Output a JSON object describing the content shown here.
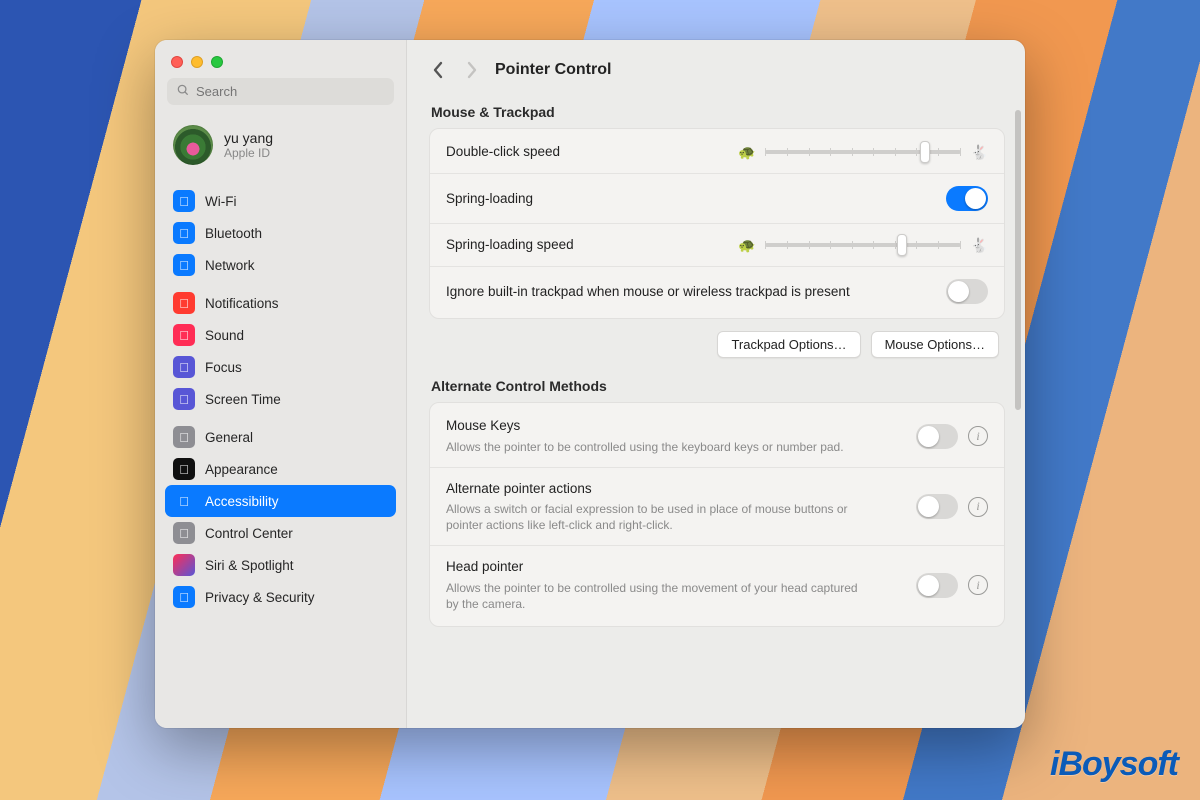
{
  "window": {
    "title": "Pointer Control"
  },
  "search": {
    "placeholder": "Search"
  },
  "account": {
    "name": "yu yang",
    "sub": "Apple ID"
  },
  "sidebar": {
    "selected": "accessibility",
    "groups": [
      {
        "items": [
          {
            "id": "wifi",
            "label": "Wi-Fi",
            "iconClass": "ic-wifi",
            "glyph": "􀙇"
          },
          {
            "id": "bluetooth",
            "label": "Bluetooth",
            "iconClass": "ic-bt",
            "glyph": "􀖀"
          },
          {
            "id": "network",
            "label": "Network",
            "iconClass": "ic-net",
            "glyph": "􀤆"
          }
        ]
      },
      {
        "items": [
          {
            "id": "notifications",
            "label": "Notifications",
            "iconClass": "ic-notif",
            "glyph": "􀋚"
          },
          {
            "id": "sound",
            "label": "Sound",
            "iconClass": "ic-sound",
            "glyph": "􀊨"
          },
          {
            "id": "focus",
            "label": "Focus",
            "iconClass": "ic-focus",
            "glyph": "􀆺"
          },
          {
            "id": "screentime",
            "label": "Screen Time",
            "iconClass": "ic-screen",
            "glyph": "􀐫"
          }
        ]
      },
      {
        "items": [
          {
            "id": "general",
            "label": "General",
            "iconClass": "ic-general",
            "glyph": "􀍟"
          },
          {
            "id": "appearance",
            "label": "Appearance",
            "iconClass": "ic-appear",
            "glyph": "􀀻"
          },
          {
            "id": "accessibility",
            "label": "Accessibility",
            "iconClass": "ic-access",
            "glyph": "􀕽"
          },
          {
            "id": "controlcenter",
            "label": "Control Center",
            "iconClass": "ic-cc",
            "glyph": "􀜊"
          },
          {
            "id": "siri",
            "label": "Siri & Spotlight",
            "iconClass": "ic-siri",
            "glyph": ""
          },
          {
            "id": "privacy",
            "label": "Privacy & Security",
            "iconClass": "ic-priv",
            "glyph": "􀉼"
          }
        ]
      }
    ]
  },
  "sections": {
    "mouseTrackpad": {
      "title": "Mouse & Trackpad",
      "doubleClick": {
        "label": "Double-click speed",
        "value": 0.82
      },
      "springLoading": {
        "label": "Spring-loading",
        "on": true
      },
      "springSpeed": {
        "label": "Spring-loading speed",
        "value": 0.7
      },
      "ignoreTrackpad": {
        "label": "Ignore built-in trackpad when mouse or wireless trackpad is present",
        "on": false
      },
      "buttons": {
        "trackpad": "Trackpad Options…",
        "mouse": "Mouse Options…"
      }
    },
    "alternate": {
      "title": "Alternate Control Methods",
      "mouseKeys": {
        "label": "Mouse Keys",
        "desc": "Allows the pointer to be controlled using the keyboard keys or number pad.",
        "on": false
      },
      "altPointer": {
        "label": "Alternate pointer actions",
        "desc": "Allows a switch or facial expression to be used in place of mouse buttons or pointer actions like left-click and right-click.",
        "on": false
      },
      "headPointer": {
        "label": "Head pointer",
        "desc": "Allows the pointer to be controlled using the movement of your head captured by the camera.",
        "on": false
      }
    }
  },
  "watermark": "iBoysoft"
}
